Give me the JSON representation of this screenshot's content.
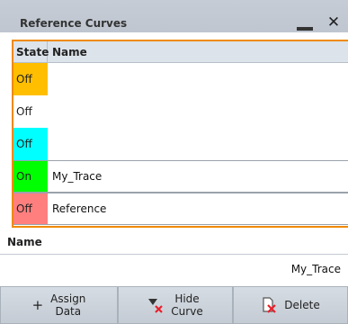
{
  "dialog": {
    "title": "Reference Curves",
    "minimize_icon": "minimize-icon",
    "close_glyph": "✕"
  },
  "table": {
    "headers": {
      "state": "State",
      "name": "Name"
    },
    "rows": [
      {
        "state": "Off",
        "name": "",
        "color": "#ffbf00"
      },
      {
        "state": "Off",
        "name": "",
        "color": "#ffffff"
      },
      {
        "state": "Off",
        "name": "",
        "color": "#00ffff"
      },
      {
        "state": "On",
        "name": "My_Trace",
        "color": "#00ff00"
      },
      {
        "state": "Off",
        "name": "Reference",
        "color": "#ff7f7f"
      }
    ]
  },
  "name_section": {
    "label": "Name",
    "value": "My_Trace"
  },
  "buttons": {
    "assign_line1": "Assign",
    "assign_line2": "Data",
    "hide_line1": "Hide",
    "hide_line2": "Curve",
    "delete": "Delete"
  },
  "colors": {
    "selection_border": "#f08a00",
    "delete_x": "#e8202a"
  }
}
